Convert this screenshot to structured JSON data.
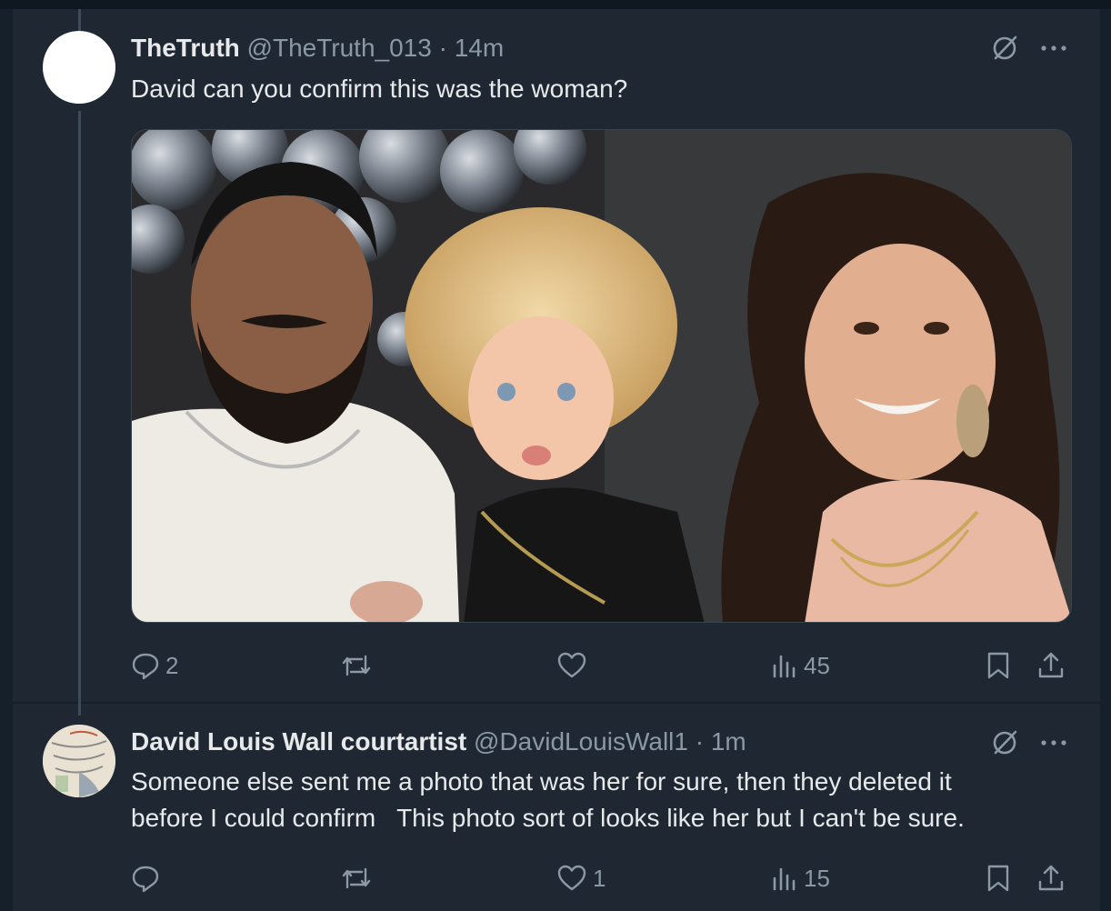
{
  "tweets": [
    {
      "name": "TheTruth",
      "handle": "@TheTruth_013",
      "separator": "·",
      "time": "14m",
      "text": "David can you confirm this was the woman?",
      "stats": {
        "replies": "2",
        "reposts": "",
        "likes": "",
        "views": "45"
      },
      "has_media": true
    },
    {
      "name": "David Louis Wall courtartist",
      "handle": "@DavidLouisWall1",
      "separator": "·",
      "time": "1m",
      "text_lines": [
        "Someone else sent me a photo that was her for sure, then they deleted it",
        "before I could confirm   This photo sort of looks like her but I can't be sure."
      ],
      "stats": {
        "replies": "",
        "reposts": "",
        "likes": "1",
        "views": "15"
      }
    }
  ],
  "icons": [
    "grok-icon",
    "more-icon",
    "reply-icon",
    "repost-icon",
    "like-icon",
    "views-icon",
    "bookmark-icon",
    "share-icon"
  ],
  "colors": {
    "background": "#15202b",
    "panel": "#1e2732",
    "muted": "#8b98a5",
    "text": "#e7e9ea",
    "thread_line": "#3f4a57"
  }
}
